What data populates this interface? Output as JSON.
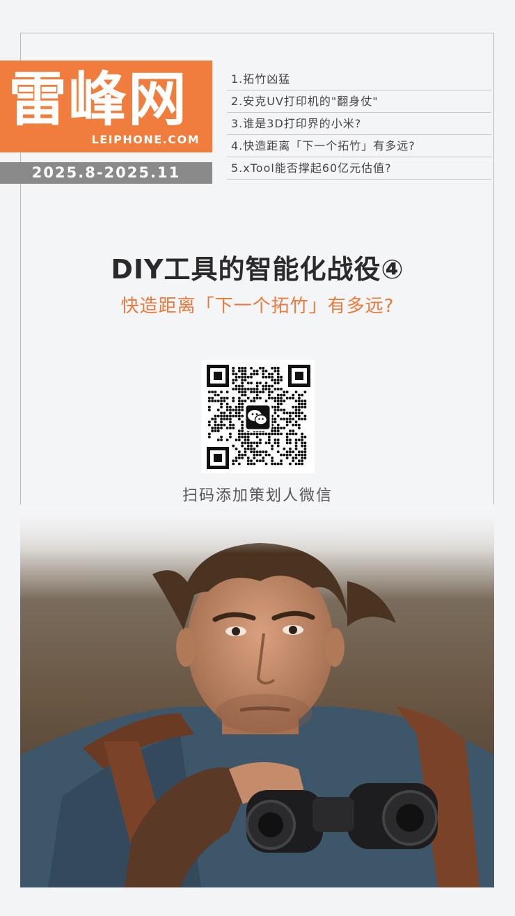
{
  "logo": {
    "chinese": "雷峰网",
    "english": "LEIPHONE.COM"
  },
  "date_range": "2025.8-2025.11",
  "series_toc": [
    "1.拓竹凶猛",
    "2.安克UV打印机的\"翻身仗\"",
    "3.谁是3D打印界的小米?",
    "4.快造距离「下一个拓竹」有多远?",
    "5.xTool能否撑起60亿元估值?"
  ],
  "title": "DIY工具的智能化战役④",
  "subtitle": "快造距离「下一个拓竹」有多远?",
  "qr": {
    "center_icon": "wechat-icon",
    "caption": "扫码添加策划人微信"
  },
  "colors": {
    "accent": "#f07d3d",
    "subtitle": "#ea7a3d",
    "date_bg": "#8a8a8a",
    "background": "#f3f4f6"
  }
}
